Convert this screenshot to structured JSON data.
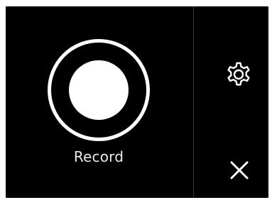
{
  "recorder": {
    "record_label": "Record"
  },
  "icons": {
    "record": "record-icon",
    "settings": "gear-icon",
    "close": "close-icon"
  },
  "colors": {
    "background": "#000000",
    "foreground": "#ffffff",
    "divider": "#3a3a3a"
  }
}
